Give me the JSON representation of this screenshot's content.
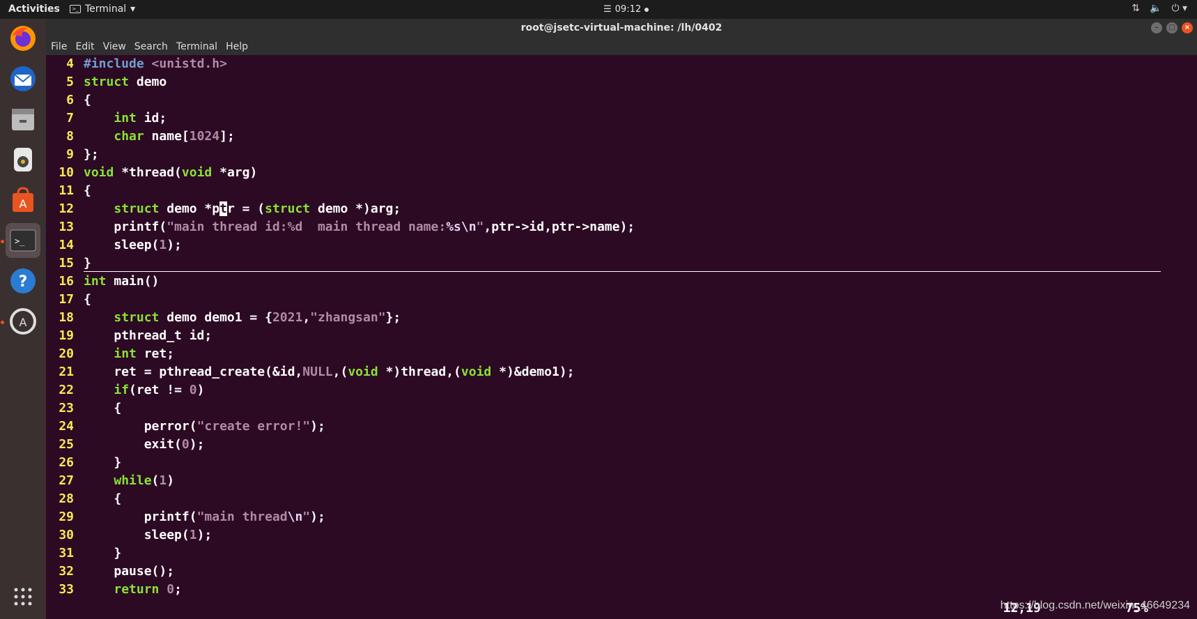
{
  "topbar": {
    "activities": "Activities",
    "app_menu": "Terminal",
    "clock": "09:12",
    "status_icons": [
      "network-icon",
      "volume-icon",
      "power-icon"
    ]
  },
  "dock": {
    "items": [
      "firefox-icon",
      "thunderbird-icon",
      "files-icon",
      "rhythmbox-icon",
      "software-center-icon",
      "terminal-icon",
      "help-icon",
      "software-updater-icon"
    ]
  },
  "window": {
    "title": "root@jsetc-virtual-machine: /lh/0402",
    "menu": [
      "File",
      "Edit",
      "View",
      "Search",
      "Terminal",
      "Help"
    ]
  },
  "editor": {
    "status_position": "12,19",
    "status_percent": "75%",
    "watermark": "https://blog.csdn.net/weixin_46649234"
  }
}
